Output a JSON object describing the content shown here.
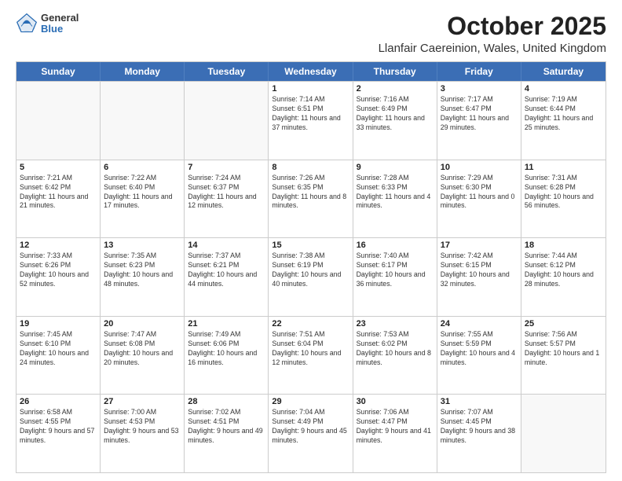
{
  "header": {
    "logo": {
      "general": "General",
      "blue": "Blue"
    },
    "month": "October 2025",
    "location": "Llanfair Caereinion, Wales, United Kingdom"
  },
  "weekdays": [
    "Sunday",
    "Monday",
    "Tuesday",
    "Wednesday",
    "Thursday",
    "Friday",
    "Saturday"
  ],
  "rows": [
    [
      {
        "day": "",
        "empty": true
      },
      {
        "day": "",
        "empty": true
      },
      {
        "day": "",
        "empty": true
      },
      {
        "day": "1",
        "sunrise": "7:14 AM",
        "sunset": "6:51 PM",
        "daylight": "11 hours and 37 minutes."
      },
      {
        "day": "2",
        "sunrise": "7:16 AM",
        "sunset": "6:49 PM",
        "daylight": "11 hours and 33 minutes."
      },
      {
        "day": "3",
        "sunrise": "7:17 AM",
        "sunset": "6:47 PM",
        "daylight": "11 hours and 29 minutes."
      },
      {
        "day": "4",
        "sunrise": "7:19 AM",
        "sunset": "6:44 PM",
        "daylight": "11 hours and 25 minutes."
      }
    ],
    [
      {
        "day": "5",
        "sunrise": "7:21 AM",
        "sunset": "6:42 PM",
        "daylight": "11 hours and 21 minutes."
      },
      {
        "day": "6",
        "sunrise": "7:22 AM",
        "sunset": "6:40 PM",
        "daylight": "11 hours and 17 minutes."
      },
      {
        "day": "7",
        "sunrise": "7:24 AM",
        "sunset": "6:37 PM",
        "daylight": "11 hours and 12 minutes."
      },
      {
        "day": "8",
        "sunrise": "7:26 AM",
        "sunset": "6:35 PM",
        "daylight": "11 hours and 8 minutes."
      },
      {
        "day": "9",
        "sunrise": "7:28 AM",
        "sunset": "6:33 PM",
        "daylight": "11 hours and 4 minutes."
      },
      {
        "day": "10",
        "sunrise": "7:29 AM",
        "sunset": "6:30 PM",
        "daylight": "11 hours and 0 minutes."
      },
      {
        "day": "11",
        "sunrise": "7:31 AM",
        "sunset": "6:28 PM",
        "daylight": "10 hours and 56 minutes."
      }
    ],
    [
      {
        "day": "12",
        "sunrise": "7:33 AM",
        "sunset": "6:26 PM",
        "daylight": "10 hours and 52 minutes."
      },
      {
        "day": "13",
        "sunrise": "7:35 AM",
        "sunset": "6:23 PM",
        "daylight": "10 hours and 48 minutes."
      },
      {
        "day": "14",
        "sunrise": "7:37 AM",
        "sunset": "6:21 PM",
        "daylight": "10 hours and 44 minutes."
      },
      {
        "day": "15",
        "sunrise": "7:38 AM",
        "sunset": "6:19 PM",
        "daylight": "10 hours and 40 minutes."
      },
      {
        "day": "16",
        "sunrise": "7:40 AM",
        "sunset": "6:17 PM",
        "daylight": "10 hours and 36 minutes."
      },
      {
        "day": "17",
        "sunrise": "7:42 AM",
        "sunset": "6:15 PM",
        "daylight": "10 hours and 32 minutes."
      },
      {
        "day": "18",
        "sunrise": "7:44 AM",
        "sunset": "6:12 PM",
        "daylight": "10 hours and 28 minutes."
      }
    ],
    [
      {
        "day": "19",
        "sunrise": "7:45 AM",
        "sunset": "6:10 PM",
        "daylight": "10 hours and 24 minutes."
      },
      {
        "day": "20",
        "sunrise": "7:47 AM",
        "sunset": "6:08 PM",
        "daylight": "10 hours and 20 minutes."
      },
      {
        "day": "21",
        "sunrise": "7:49 AM",
        "sunset": "6:06 PM",
        "daylight": "10 hours and 16 minutes."
      },
      {
        "day": "22",
        "sunrise": "7:51 AM",
        "sunset": "6:04 PM",
        "daylight": "10 hours and 12 minutes."
      },
      {
        "day": "23",
        "sunrise": "7:53 AM",
        "sunset": "6:02 PM",
        "daylight": "10 hours and 8 minutes."
      },
      {
        "day": "24",
        "sunrise": "7:55 AM",
        "sunset": "5:59 PM",
        "daylight": "10 hours and 4 minutes."
      },
      {
        "day": "25",
        "sunrise": "7:56 AM",
        "sunset": "5:57 PM",
        "daylight": "10 hours and 1 minute."
      }
    ],
    [
      {
        "day": "26",
        "sunrise": "6:58 AM",
        "sunset": "4:55 PM",
        "daylight": "9 hours and 57 minutes."
      },
      {
        "day": "27",
        "sunrise": "7:00 AM",
        "sunset": "4:53 PM",
        "daylight": "9 hours and 53 minutes."
      },
      {
        "day": "28",
        "sunrise": "7:02 AM",
        "sunset": "4:51 PM",
        "daylight": "9 hours and 49 minutes."
      },
      {
        "day": "29",
        "sunrise": "7:04 AM",
        "sunset": "4:49 PM",
        "daylight": "9 hours and 45 minutes."
      },
      {
        "day": "30",
        "sunrise": "7:06 AM",
        "sunset": "4:47 PM",
        "daylight": "9 hours and 41 minutes."
      },
      {
        "day": "31",
        "sunrise": "7:07 AM",
        "sunset": "4:45 PM",
        "daylight": "9 hours and 38 minutes."
      },
      {
        "day": "",
        "empty": true
      }
    ]
  ]
}
